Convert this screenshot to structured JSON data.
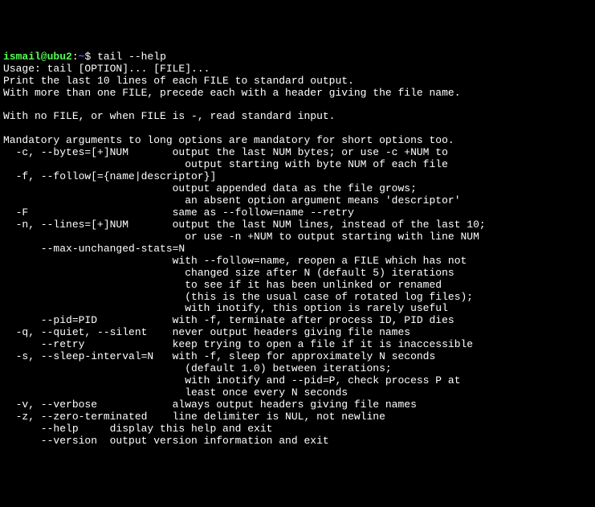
{
  "prompt": {
    "user_host": "ismail@ubu2",
    "colon": ":",
    "path": "~",
    "dollar": "$ "
  },
  "command": "tail --help",
  "output_lines": [
    "Usage: tail [OPTION]... [FILE]...",
    "Print the last 10 lines of each FILE to standard output.",
    "With more than one FILE, precede each with a header giving the file name.",
    "",
    "With no FILE, or when FILE is -, read standard input.",
    "",
    "Mandatory arguments to long options are mandatory for short options too.",
    "  -c, --bytes=[+]NUM       output the last NUM bytes; or use -c +NUM to",
    "                             output starting with byte NUM of each file",
    "  -f, --follow[={name|descriptor}]",
    "                           output appended data as the file grows;",
    "                             an absent option argument means 'descriptor'",
    "  -F                       same as --follow=name --retry",
    "  -n, --lines=[+]NUM       output the last NUM lines, instead of the last 10;",
    "                             or use -n +NUM to output starting with line NUM",
    "      --max-unchanged-stats=N",
    "                           with --follow=name, reopen a FILE which has not",
    "                             changed size after N (default 5) iterations",
    "                             to see if it has been unlinked or renamed",
    "                             (this is the usual case of rotated log files);",
    "                             with inotify, this option is rarely useful",
    "      --pid=PID            with -f, terminate after process ID, PID dies",
    "  -q, --quiet, --silent    never output headers giving file names",
    "      --retry              keep trying to open a file if it is inaccessible",
    "  -s, --sleep-interval=N   with -f, sleep for approximately N seconds",
    "                             (default 1.0) between iterations;",
    "                             with inotify and --pid=P, check process P at",
    "                             least once every N seconds",
    "  -v, --verbose            always output headers giving file names",
    "  -z, --zero-terminated    line delimiter is NUL, not newline",
    "      --help     display this help and exit",
    "      --version  output version information and exit"
  ]
}
